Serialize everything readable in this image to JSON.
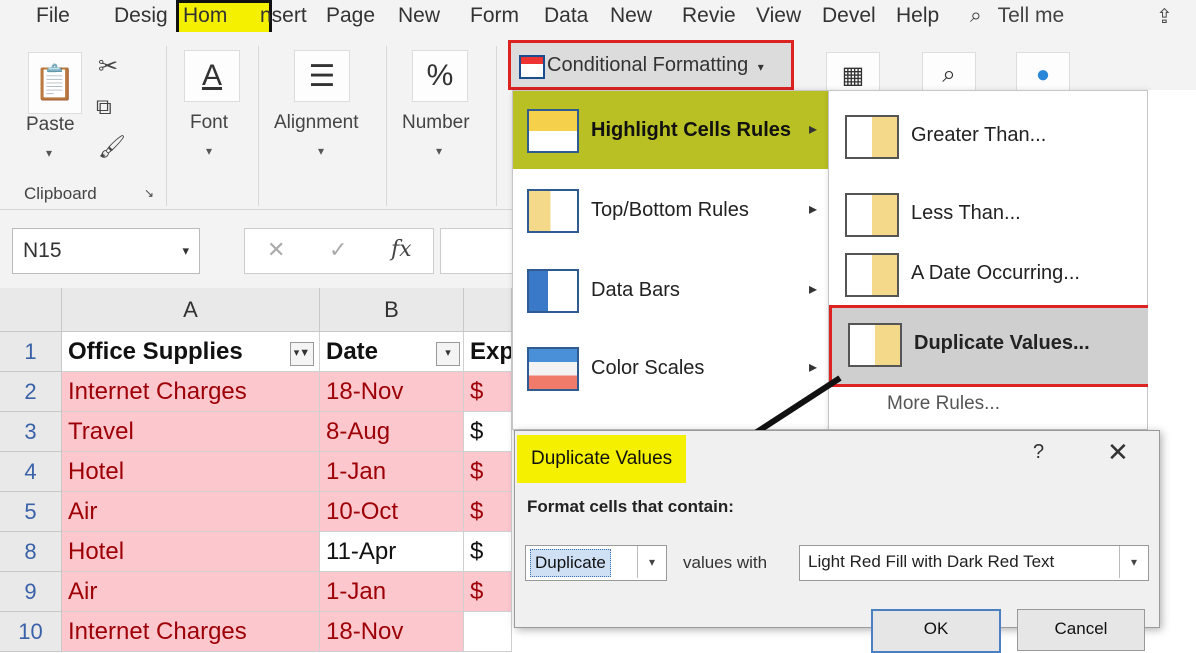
{
  "tabs": [
    "File",
    "Desig",
    "Hom",
    "nsert",
    "Page",
    "New",
    "Form",
    "Data",
    "New",
    "Revie",
    "View",
    "Devel",
    "Help"
  ],
  "tell_me": "Tell me",
  "ribbon": {
    "paste": "Paste",
    "clipboard": "Clipboard",
    "font": "Font",
    "alignment": "Alignment",
    "number": "Number",
    "number_icon": "%",
    "conditional_formatting": "Conditional Formatting"
  },
  "formula": {
    "name_box": "N15",
    "fx": "fx"
  },
  "grid": {
    "columns": [
      "A",
      "B"
    ],
    "header_row": {
      "row": "1",
      "a": "Office Supplies",
      "b": "Date",
      "c": "Exp"
    },
    "rows": [
      {
        "row": "2",
        "a": "Internet Charges",
        "b": "18-Nov",
        "c": "$"
      },
      {
        "row": "3",
        "a": "Travel",
        "b": "8-Aug",
        "c": "$"
      },
      {
        "row": "4",
        "a": "Hotel",
        "b": "1-Jan",
        "c": "$"
      },
      {
        "row": "5",
        "a": "Air",
        "b": "10-Oct",
        "c": "$"
      },
      {
        "row": "8",
        "a": "Hotel",
        "b": "11-Apr",
        "c": "$"
      },
      {
        "row": "9",
        "a": "Air",
        "b": "1-Jan",
        "c": "$"
      },
      {
        "row": "10",
        "a": "Internet Charges",
        "b": "18-Nov",
        "c": ""
      }
    ]
  },
  "cf_menu": [
    "Highlight Cells Rules",
    "Top/Bottom Rules",
    "Data Bars",
    "Color Scales"
  ],
  "submenu": [
    "Greater Than...",
    "Less Than...",
    "A Date Occurring...",
    "Duplicate Values...",
    "More Rules..."
  ],
  "dialog": {
    "title": "Duplicate Values",
    "help": "?",
    "close": "✕",
    "label": "Format cells that contain:",
    "type_value": "Duplicate",
    "values_with": "values with",
    "format_value": "Light Red Fill with Dark Red Text",
    "ok": "OK",
    "cancel": "Cancel"
  },
  "colors": {
    "duplicate_fill": "#fdc7ce",
    "duplicate_text": "#9c0006",
    "highlight": "#f4f000",
    "menu_active": "#b9c023",
    "callout_border": "#d22222"
  }
}
